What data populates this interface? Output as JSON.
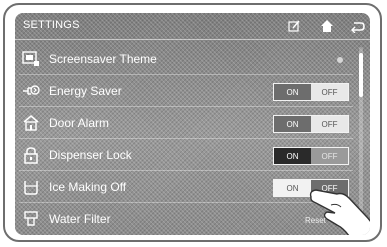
{
  "header": {
    "title": "SETTINGS",
    "icons": [
      "edit-icon",
      "home-icon",
      "back-icon"
    ]
  },
  "rows": [
    {
      "label": "Screensaver Theme",
      "icon": "screensaver-icon"
    },
    {
      "label": "Energy Saver",
      "icon": "energy-saver-icon",
      "toggle": {
        "on": "ON",
        "off": "OFF",
        "selected": "OFF"
      }
    },
    {
      "label": "Door Alarm",
      "icon": "door-alarm-icon",
      "toggle": {
        "on": "ON",
        "off": "OFF",
        "selected": "OFF"
      }
    },
    {
      "label": "Dispenser Lock",
      "icon": "lock-icon",
      "toggle": {
        "on": "ON",
        "off": "OFF",
        "selected": "ON"
      }
    },
    {
      "label": "Ice Making Off",
      "icon": "ice-maker-icon",
      "toggle": {
        "on": "ON",
        "off": "OFF",
        "selected": "OFF"
      }
    },
    {
      "label": "Water Filter",
      "icon": "water-filter-icon",
      "action": "Reset"
    }
  ],
  "colors": {
    "screen": "#8a8a8a",
    "text": "#ffffff",
    "on_bg": "#2a2a2a",
    "off_bg": "#e8e8e8"
  }
}
